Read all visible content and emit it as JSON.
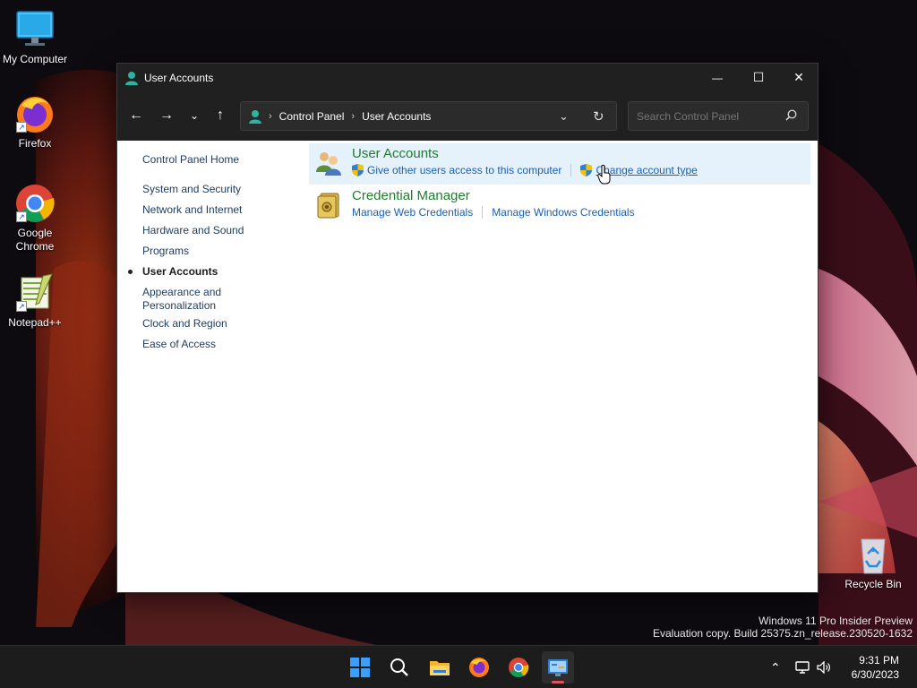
{
  "desktop": {
    "icons": [
      {
        "label": "My Computer"
      },
      {
        "label": "Firefox"
      },
      {
        "label": "Google Chrome"
      },
      {
        "label": "Notepad++"
      },
      {
        "label": "Recycle Bin"
      }
    ],
    "watermark": {
      "line1": "Windows 11 Pro Insider Preview",
      "line2": "Evaluation copy. Build 25375.zn_release.230520-1632"
    }
  },
  "window": {
    "title": "User Accounts",
    "controls": {
      "minimize": "—",
      "maximize": "☐",
      "close": "✕"
    },
    "address": {
      "breadcrumb": [
        "Control Panel",
        "User Accounts"
      ]
    },
    "search": {
      "placeholder": "Search Control Panel"
    },
    "sidebar": {
      "items": [
        {
          "label": "Control Panel Home"
        },
        {
          "label": "System and Security"
        },
        {
          "label": "Network and Internet"
        },
        {
          "label": "Hardware and Sound"
        },
        {
          "label": "Programs"
        },
        {
          "label": "User Accounts",
          "active": true
        },
        {
          "label": "Appearance and Personalization"
        },
        {
          "label": "Clock and Region"
        },
        {
          "label": "Ease of Access"
        }
      ]
    },
    "categories": [
      {
        "title": "User Accounts",
        "links": [
          {
            "label": "Give other users access to this computer",
            "shield": true
          },
          {
            "label": "Change account type",
            "shield": true
          }
        ]
      },
      {
        "title": "Credential Manager",
        "links": [
          {
            "label": "Manage Web Credentials",
            "shield": false
          },
          {
            "label": "Manage Windows Credentials",
            "shield": false
          }
        ]
      }
    ]
  },
  "taskbar": {
    "apps": [
      "start-icon",
      "search-icon",
      "file-explorer-icon",
      "firefox-icon",
      "chrome-icon",
      "control-panel-icon"
    ],
    "clock": {
      "time": "9:31 PM",
      "date": "6/30/2023"
    }
  },
  "colors": {
    "accent": "#1a5fb4",
    "category_title": "#1e7c2f",
    "highlight": "#e5f1fb",
    "titlebar": "#202020"
  }
}
